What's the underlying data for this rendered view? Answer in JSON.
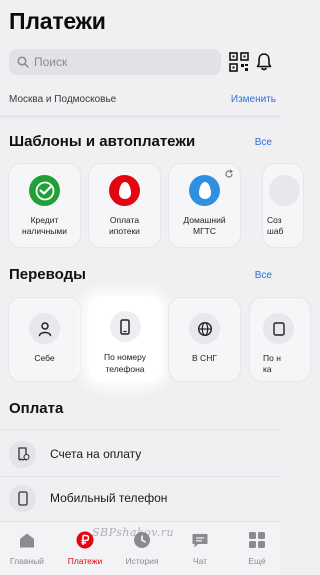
{
  "header": {
    "title": "Платежи"
  },
  "search": {
    "placeholder": "Поиск"
  },
  "toolbar": {
    "qr_icon": "qr-code-icon",
    "bell_icon": "bell-icon"
  },
  "region": {
    "name": "Москва и Подмосковье",
    "change_label": "Изменить"
  },
  "templates": {
    "title": "Шаблоны и автоплатежи",
    "all_label": "Все",
    "items": [
      {
        "label": "Кредит\nналичными",
        "icon": "sber-logo-icon",
        "color": "#21a038"
      },
      {
        "label": "Оплата\nипотеки",
        "icon": "mts-egg-logo-icon",
        "color": "#e30611"
      },
      {
        "label": "Домашний\nМГТС",
        "icon": "mgts-egg-logo-icon",
        "color": "#2f8fe0"
      },
      {
        "label": "Соз\nшаб",
        "icon": "add-template-icon",
        "color": "#e8e8ec"
      }
    ]
  },
  "transfers": {
    "title": "Переводы",
    "all_label": "Все",
    "items": [
      {
        "label": "Себе",
        "icon": "person-icon"
      },
      {
        "label": "По номеру\nтелефона",
        "icon": "phone-icon"
      },
      {
        "label": "В СНГ",
        "icon": "globe-icon"
      },
      {
        "label": "По н\nка",
        "icon": "card-icon"
      }
    ]
  },
  "payment": {
    "title": "Оплата",
    "items": [
      {
        "label": "Счета на оплату",
        "icon": "bill-icon"
      },
      {
        "label": "Мобильный телефон",
        "icon": "mobile-phone-icon"
      }
    ]
  },
  "tabbar": {
    "items": [
      {
        "label": "Главный",
        "icon": "home-icon",
        "active": false
      },
      {
        "label": "Платежи",
        "icon": "ruble-icon",
        "active": true
      },
      {
        "label": "История",
        "icon": "clock-icon",
        "active": false
      },
      {
        "label": "Чат",
        "icon": "chat-icon",
        "active": false
      },
      {
        "label": "Ещё",
        "icon": "grid-icon",
        "active": false
      }
    ]
  },
  "watermark": "SBPshakov.ru",
  "colors": {
    "accent": "#2f6fd6",
    "brand_red": "#e30611",
    "background": "#f0f0f2"
  }
}
